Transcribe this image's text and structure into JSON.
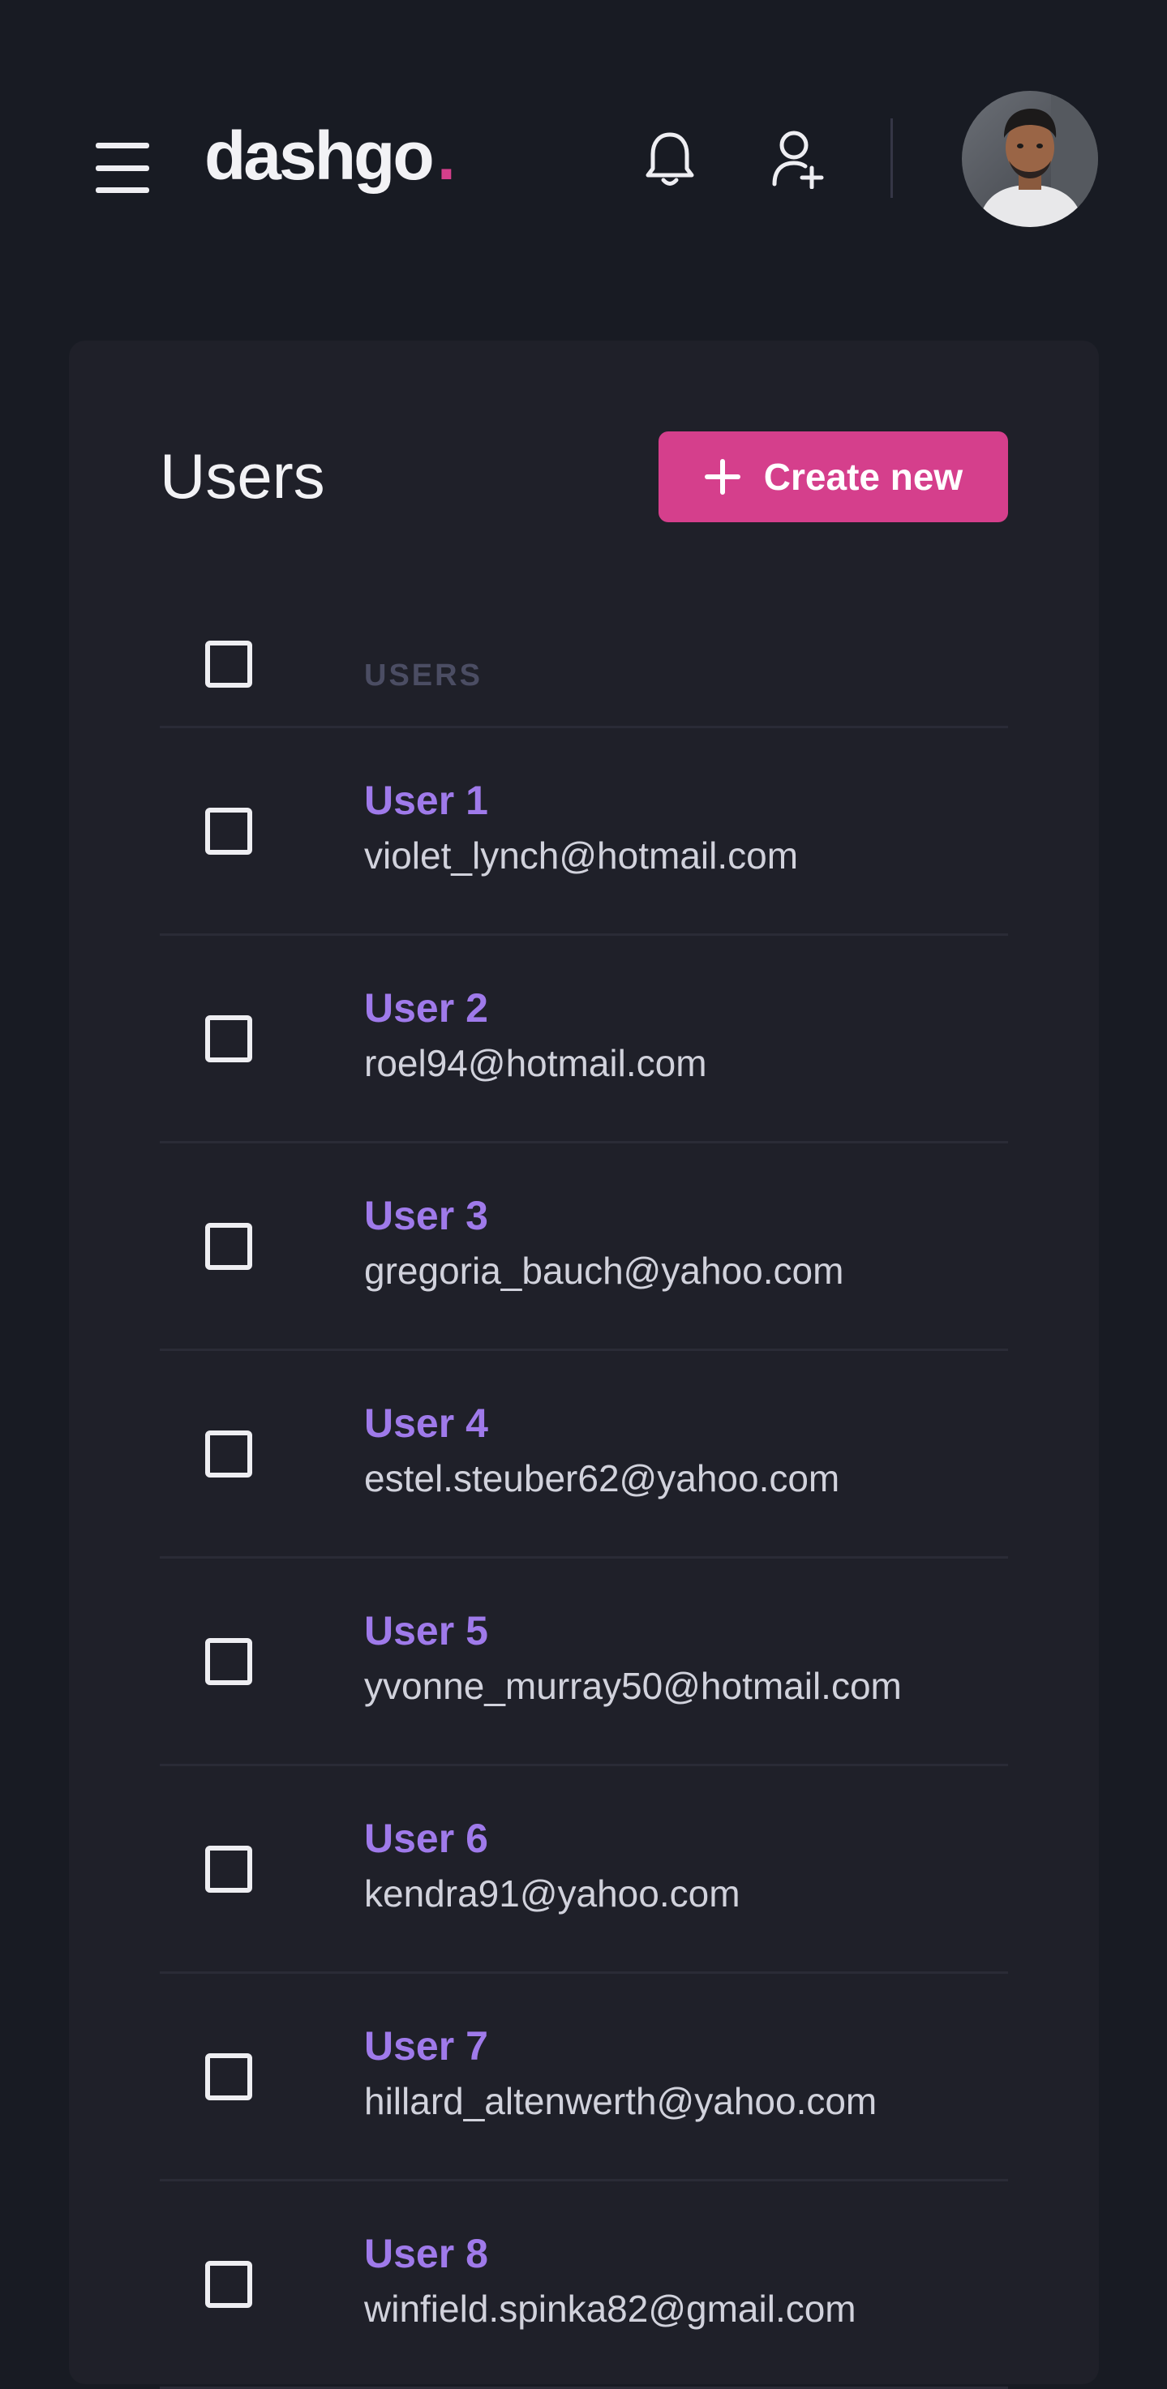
{
  "header": {
    "menu_icon": "hamburger-menu-icon",
    "logo": {
      "text": "dashgo",
      "dot": "."
    },
    "notification_icon": "bell-icon",
    "add_user_icon": "user-plus-icon",
    "avatar": "user-avatar-photo"
  },
  "main": {
    "title": "Users",
    "create_button": {
      "label": "Create new",
      "icon": "plus-icon"
    },
    "table": {
      "column_header": "USERS",
      "rows": [
        {
          "name": "User 1",
          "email": "violet_lynch@hotmail.com"
        },
        {
          "name": "User 2",
          "email": "roel94@hotmail.com"
        },
        {
          "name": "User 3",
          "email": "gregoria_bauch@yahoo.com"
        },
        {
          "name": "User 4",
          "email": "estel.steuber62@yahoo.com"
        },
        {
          "name": "User 5",
          "email": "yvonne_murray50@hotmail.com"
        },
        {
          "name": "User 6",
          "email": "kendra91@yahoo.com"
        },
        {
          "name": "User 7",
          "email": "hillard_altenwerth@yahoo.com"
        },
        {
          "name": "User 8",
          "email": "winfield.spinka82@gmail.com"
        }
      ]
    }
  },
  "colors": {
    "background": "#181b23",
    "card": "#1f2029",
    "accent_pink": "#d53f8c",
    "user_name_purple": "#9f7aea",
    "header_muted": "#4b4d63"
  }
}
